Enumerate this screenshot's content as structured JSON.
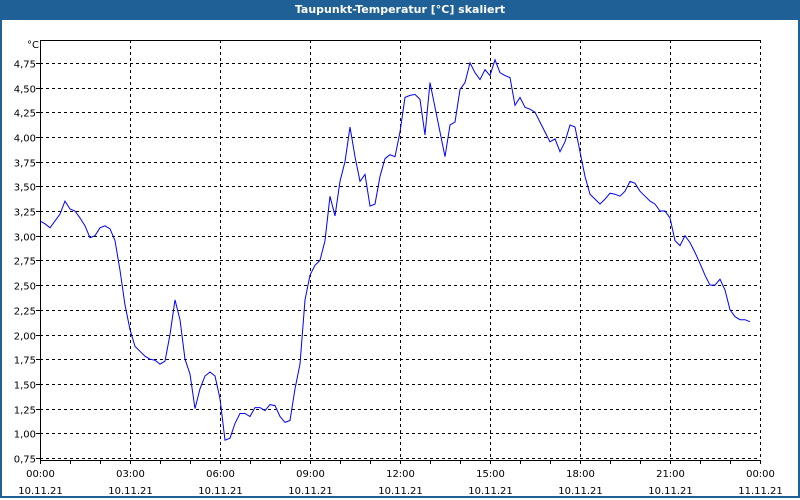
{
  "window": {
    "title": "Taupunkt-Temperatur [°C] skaliert"
  },
  "chart_data": {
    "type": "line",
    "title": "Taupunkt-Temperatur [°C] skaliert",
    "ylabel": "°C",
    "xlabel": "",
    "ylim": [
      0.75,
      4.8
    ],
    "xlim_hours": [
      0,
      24
    ],
    "grid": true,
    "yticks": [
      "0,75",
      "1,00",
      "1,25",
      "1,50",
      "1,75",
      "2,00",
      "2,25",
      "2,50",
      "2,75",
      "3,00",
      "3,25",
      "3,50",
      "3,75",
      "4,00",
      "4,25",
      "4,50",
      "4,75"
    ],
    "xticks": [
      {
        "time": "00:00",
        "date": "10.11.21"
      },
      {
        "time": "03:00",
        "date": "10.11.21"
      },
      {
        "time": "06:00",
        "date": "10.11.21"
      },
      {
        "time": "09:00",
        "date": "10.11.21"
      },
      {
        "time": "12:00",
        "date": "10.11.21"
      },
      {
        "time": "15:00",
        "date": "10.11.21"
      },
      {
        "time": "18:00",
        "date": "10.11.21"
      },
      {
        "time": "21:00",
        "date": "10.11.21"
      },
      {
        "time": "00:00",
        "date": "11.11.21"
      }
    ],
    "series": [
      {
        "name": "Taupunkt-Temperatur",
        "color": "#0000ff",
        "start_hour": 0,
        "interval_minutes": 10,
        "values": [
          3.15,
          3.12,
          3.08,
          3.15,
          3.22,
          3.35,
          3.27,
          3.25,
          3.18,
          3.1,
          2.98,
          3.0,
          3.08,
          3.1,
          3.07,
          2.95,
          2.65,
          2.3,
          2.05,
          1.88,
          1.83,
          1.78,
          1.75,
          1.74,
          1.7,
          1.73,
          2.0,
          2.35,
          2.15,
          1.75,
          1.6,
          1.25,
          1.45,
          1.58,
          1.62,
          1.58,
          1.35,
          0.93,
          0.95,
          1.1,
          1.2,
          1.2,
          1.17,
          1.26,
          1.26,
          1.23,
          1.29,
          1.28,
          1.17,
          1.11,
          1.13,
          1.45,
          1.7,
          2.35,
          2.6,
          2.7,
          2.75,
          2.95,
          3.4,
          3.2,
          3.55,
          3.75,
          4.1,
          3.8,
          3.55,
          3.62,
          3.3,
          3.32,
          3.6,
          3.78,
          3.82,
          3.8,
          4.05,
          4.4,
          4.42,
          4.43,
          4.38,
          4.02,
          4.55,
          4.3,
          4.05,
          3.8,
          4.12,
          4.15,
          4.48,
          4.55,
          4.75,
          4.65,
          4.58,
          4.68,
          4.62,
          4.78,
          4.65,
          4.62,
          4.6,
          4.32,
          4.4,
          4.3,
          4.28,
          4.25,
          4.15,
          4.05,
          3.95,
          3.98,
          3.85,
          3.95,
          4.12,
          4.1,
          3.85,
          3.6,
          3.42,
          3.37,
          3.32,
          3.37,
          3.43,
          3.42,
          3.4,
          3.45,
          3.55,
          3.53,
          3.45,
          3.4,
          3.35,
          3.32,
          3.25,
          3.25,
          3.18,
          2.95,
          2.9,
          3.0,
          2.93,
          2.83,
          2.72,
          2.6,
          2.5,
          2.5,
          2.56,
          2.45,
          2.25,
          2.18,
          2.15,
          2.15,
          2.13
        ]
      }
    ]
  }
}
